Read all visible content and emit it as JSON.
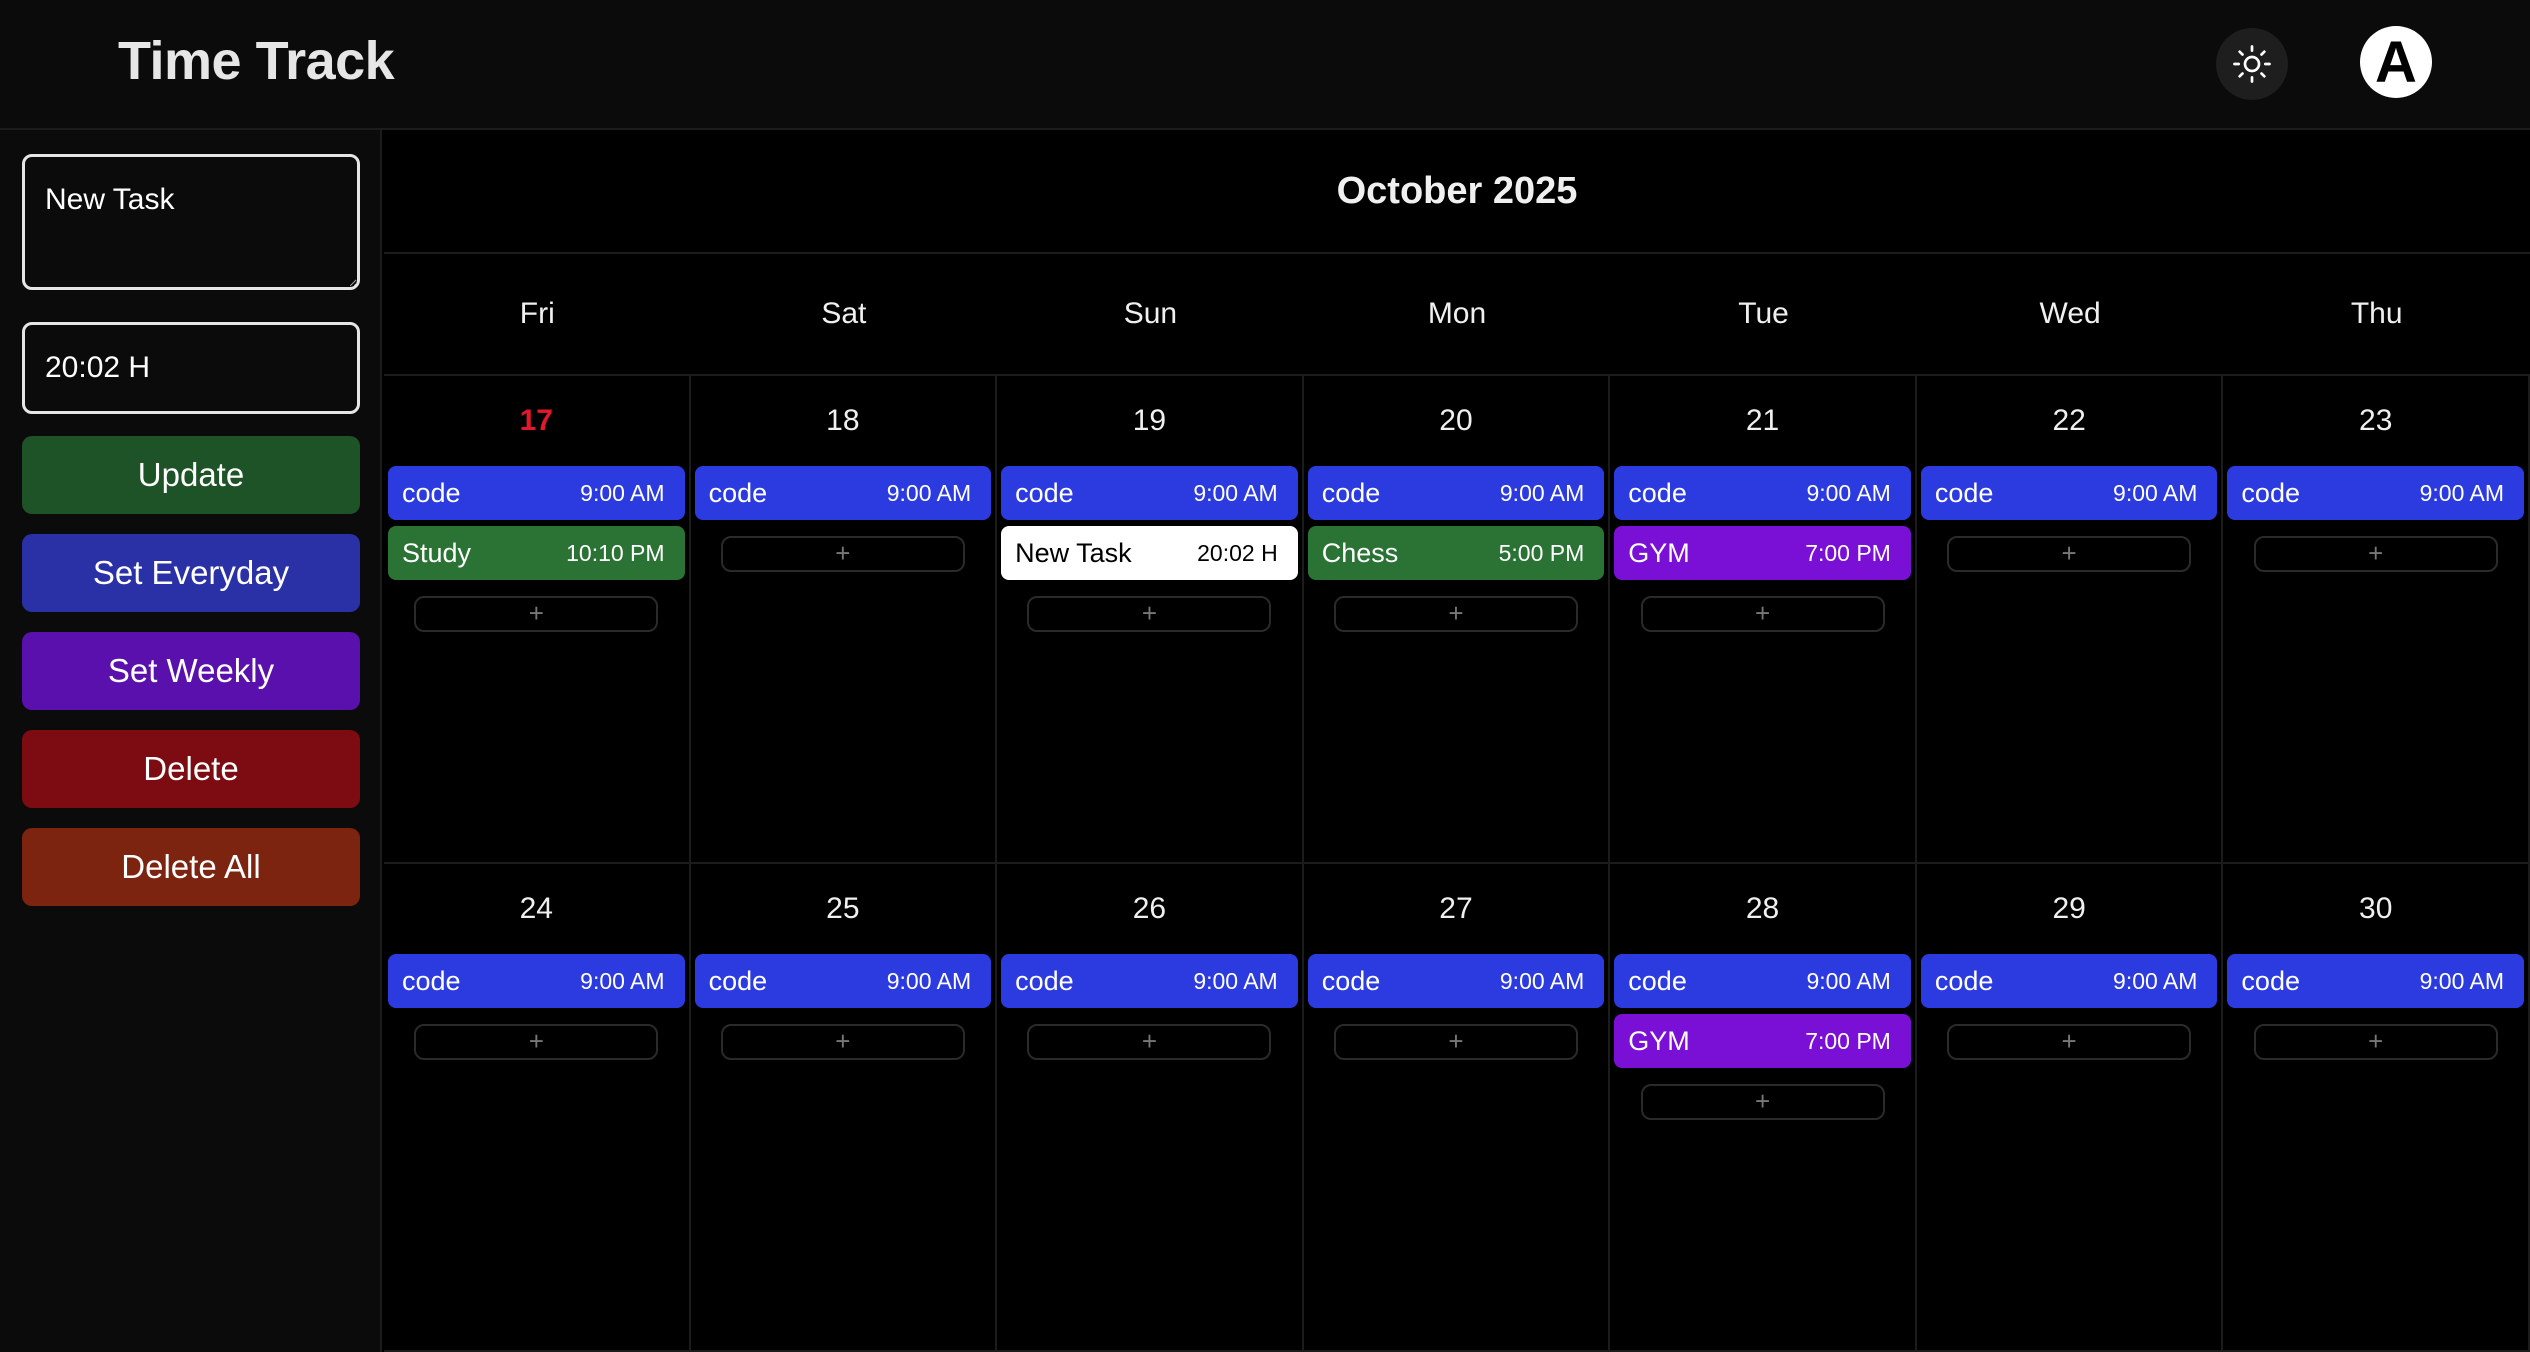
{
  "header": {
    "title": "Time Track",
    "theme_icon": "sun-icon",
    "avatar_letter": "A"
  },
  "sidebar": {
    "task_input_value": "New Task",
    "time_input_value": "20:02 H",
    "buttons": [
      {
        "id": "update",
        "label": "Update",
        "color": "#1e5227"
      },
      {
        "id": "set-everyday",
        "label": "Set Everyday",
        "color": "#2a30a6"
      },
      {
        "id": "set-weekly",
        "label": "Set Weekly",
        "color": "#5a10ac"
      },
      {
        "id": "delete",
        "label": "Delete",
        "color": "#7c0c12"
      },
      {
        "id": "delete-all",
        "label": "Delete All",
        "color": "#7c2410"
      }
    ]
  },
  "calendar": {
    "month_label": "October 2025",
    "weekdays": [
      "Fri",
      "Sat",
      "Sun",
      "Mon",
      "Tue",
      "Wed",
      "Thu"
    ],
    "add_label": "+",
    "days": [
      {
        "num": "17",
        "today": true,
        "events": [
          {
            "title": "code",
            "time": "9:00 AM",
            "kind": "code"
          },
          {
            "title": "Study",
            "time": "10:10 PM",
            "kind": "green"
          }
        ]
      },
      {
        "num": "18",
        "events": [
          {
            "title": "code",
            "time": "9:00 AM",
            "kind": "code"
          }
        ]
      },
      {
        "num": "19",
        "events": [
          {
            "title": "code",
            "time": "9:00 AM",
            "kind": "code"
          },
          {
            "title": "New Task",
            "time": "20:02 H",
            "kind": "selected"
          }
        ]
      },
      {
        "num": "20",
        "events": [
          {
            "title": "code",
            "time": "9:00 AM",
            "kind": "code"
          },
          {
            "title": "Chess",
            "time": "5:00 PM",
            "kind": "green"
          }
        ]
      },
      {
        "num": "21",
        "events": [
          {
            "title": "code",
            "time": "9:00 AM",
            "kind": "code"
          },
          {
            "title": "GYM",
            "time": "7:00 PM",
            "kind": "purple"
          }
        ]
      },
      {
        "num": "22",
        "events": [
          {
            "title": "code",
            "time": "9:00 AM",
            "kind": "code"
          }
        ]
      },
      {
        "num": "23",
        "events": [
          {
            "title": "code",
            "time": "9:00 AM",
            "kind": "code"
          }
        ]
      },
      {
        "num": "24",
        "events": [
          {
            "title": "code",
            "time": "9:00 AM",
            "kind": "code"
          }
        ]
      },
      {
        "num": "25",
        "events": [
          {
            "title": "code",
            "time": "9:00 AM",
            "kind": "code"
          }
        ]
      },
      {
        "num": "26",
        "events": [
          {
            "title": "code",
            "time": "9:00 AM",
            "kind": "code"
          }
        ]
      },
      {
        "num": "27",
        "events": [
          {
            "title": "code",
            "time": "9:00 AM",
            "kind": "code"
          }
        ]
      },
      {
        "num": "28",
        "events": [
          {
            "title": "code",
            "time": "9:00 AM",
            "kind": "code"
          },
          {
            "title": "GYM",
            "time": "7:00 PM",
            "kind": "purple"
          }
        ]
      },
      {
        "num": "29",
        "events": [
          {
            "title": "code",
            "time": "9:00 AM",
            "kind": "code"
          }
        ]
      },
      {
        "num": "30",
        "events": [
          {
            "title": "code",
            "time": "9:00 AM",
            "kind": "code"
          }
        ]
      }
    ]
  },
  "colors": {
    "code": {
      "bg": "#2b3be0",
      "fg": "#ffffff"
    },
    "green": {
      "bg": "#2a7334",
      "fg": "#ffffff"
    },
    "purple": {
      "bg": "#7a10d6",
      "fg": "#ffffff"
    },
    "selected": {
      "bg": "#ffffff",
      "fg": "#000000"
    },
    "today": "#e5182b"
  }
}
